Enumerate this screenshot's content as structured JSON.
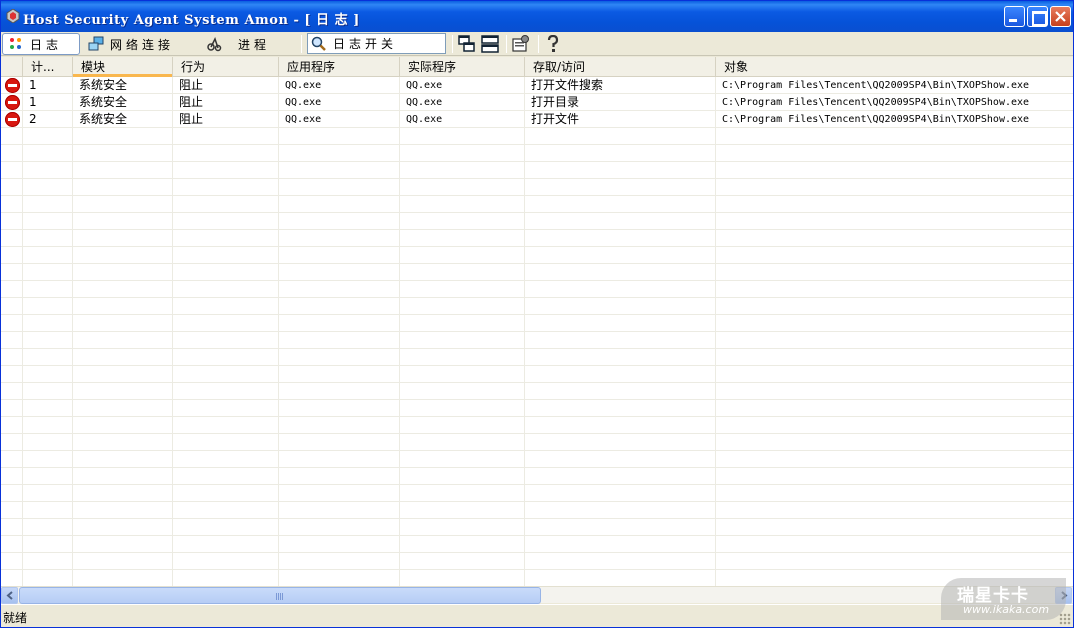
{
  "window": {
    "title": "Host Security Agent System Amon - [ 日 志 ]"
  },
  "toolbar": {
    "log_label": "日志",
    "network_label": "网络连接",
    "process_label": "进程",
    "log_switch_label": "日志开关"
  },
  "table": {
    "columns": [
      "计...",
      "模块",
      "行为",
      "应用程序",
      "实际程序",
      "存取/访问",
      "对象"
    ],
    "rows": [
      {
        "icon": "stop-icon",
        "count": "1",
        "module": "系统安全",
        "action": "阻止",
        "app": "QQ.exe",
        "actual": "QQ.exe",
        "access": "打开文件搜索",
        "object": "C:\\Program Files\\Tencent\\QQ2009SP4\\Bin\\TXOPShow.exe"
      },
      {
        "icon": "stop-icon",
        "count": "1",
        "module": "系统安全",
        "action": "阻止",
        "app": "QQ.exe",
        "actual": "QQ.exe",
        "access": "打开目录",
        "object": "C:\\Program Files\\Tencent\\QQ2009SP4\\Bin\\TXOPShow.exe"
      },
      {
        "icon": "stop-icon",
        "count": "2",
        "module": "系统安全",
        "action": "阻止",
        "app": "QQ.exe",
        "actual": "QQ.exe",
        "access": "打开文件",
        "object": "C:\\Program Files\\Tencent\\QQ2009SP4\\Bin\\TXOPShow.exe"
      }
    ]
  },
  "status": {
    "text": "就绪"
  },
  "watermark": {
    "brand": "瑞星卡卡",
    "url": "www.ikaka.com"
  },
  "colors": {
    "titlebar": "#0a52d8",
    "stop": "#d8170f",
    "sort_indicator": "#f9b74e"
  }
}
